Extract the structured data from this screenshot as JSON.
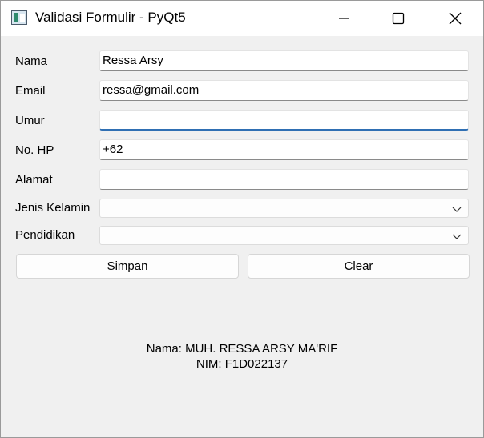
{
  "window": {
    "title": "Validasi Formulir - PyQt5",
    "controls": [
      "minimize-icon",
      "maximize-icon",
      "close-icon"
    ]
  },
  "form": {
    "nama": {
      "label": "Nama",
      "value": "Ressa Arsy"
    },
    "email": {
      "label": "Email",
      "value": "ressa@gmail.com"
    },
    "umur": {
      "label": "Umur",
      "value": ""
    },
    "no_hp": {
      "label": "No. HP",
      "value": "+62 ___ ____ ____"
    },
    "alamat": {
      "label": "Alamat",
      "value": ""
    },
    "jenis_kelamin": {
      "label": "Jenis Kelamin",
      "value": ""
    },
    "pendidikan": {
      "label": "Pendidikan",
      "value": ""
    }
  },
  "buttons": {
    "simpan": "Simpan",
    "clear": "Clear"
  },
  "footer": {
    "nama": "Nama: MUH. RESSA ARSY MA'RIF",
    "nim": "NIM: F1D022137"
  },
  "colors": {
    "background": "#f0f0f0",
    "titlebar": "#ffffff",
    "focus_accent": "#2f6fb3"
  }
}
